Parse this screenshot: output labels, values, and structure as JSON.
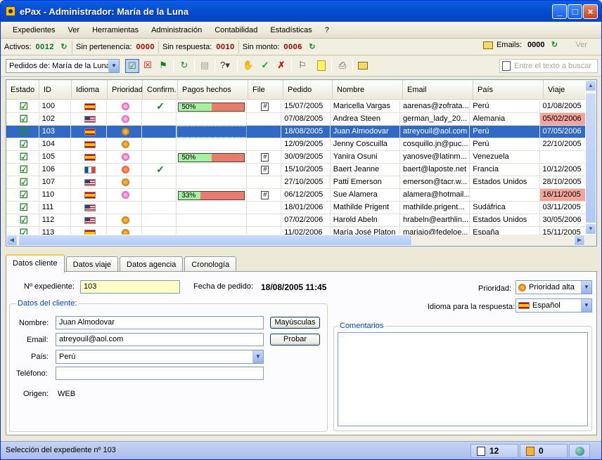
{
  "window": {
    "title": "ePax - Administrador: María de la Luna"
  },
  "menu": [
    "Expedientes",
    "Ver",
    "Herramientas",
    "Administración",
    "Contabilidad",
    "Estadísticas",
    "?"
  ],
  "counters": {
    "activos_label": "Activos:",
    "activos": "0012",
    "sin_pertenencia_label": "Sin pertenencia:",
    "sin_pertenencia": "0000",
    "sin_respuesta_label": "Sin respuesta:",
    "sin_respuesta": "0010",
    "sin_monto_label": "Sin monto:",
    "sin_monto": "0006",
    "emails_label": "Emails:",
    "emails": "0000",
    "ver_label": "Ver"
  },
  "toolbar": {
    "pedidos_combo": "Pedidos de: María de la Luna",
    "search_placeholder": "Entre el texto a buscar"
  },
  "grid": {
    "columns": [
      "Estado",
      "ID",
      "Idioma",
      "Prioridad",
      "Confirm.",
      "Pagos hechos",
      "File",
      "Pedido",
      "Nombre",
      "Email",
      "País",
      "Viaje"
    ],
    "rows": [
      {
        "id": "100",
        "lang": "es",
        "prio": "pink",
        "confirm": true,
        "pago": "50%",
        "pago_frac": 0.5,
        "file": true,
        "pedido": "15/07/2005",
        "nombre": "Maricella Vargas",
        "email": "aarenas@zofrata...",
        "pais": "Perú",
        "viaje": "01/08/2005",
        "viaje_hl": false
      },
      {
        "id": "102",
        "lang": "us",
        "prio": "pink",
        "confirm": false,
        "pago": "",
        "pago_frac": null,
        "file": false,
        "pedido": "07/08/2005",
        "nombre": "Andrea Steen",
        "email": "german_lady_20...",
        "pais": "Alemania",
        "viaje": "05/02/2006",
        "viaje_hl": true
      },
      {
        "id": "103",
        "lang": "es",
        "prio": "high",
        "confirm": false,
        "pago": "",
        "pago_frac": null,
        "file": false,
        "pedido": "18/08/2005",
        "nombre": "Juan Almodovar",
        "email": "atreyouil@aol.com",
        "pais": "Perú",
        "viaje": "07/05/2006",
        "viaje_hl": false,
        "selected": true
      },
      {
        "id": "104",
        "lang": "es",
        "prio": "high",
        "confirm": false,
        "pago": "",
        "pago_frac": null,
        "file": false,
        "pedido": "12/09/2005",
        "nombre": "Jenny Coscuilla",
        "email": "cosquillo.jn@puc...",
        "pais": "Perú",
        "viaje": "22/10/2005",
        "viaje_hl": false
      },
      {
        "id": "105",
        "lang": "es",
        "prio": "pink",
        "confirm": false,
        "pago": "50%",
        "pago_frac": 0.5,
        "file": true,
        "pedido": "30/09/2005",
        "nombre": "Yanira Osuni",
        "email": "yanosve@latinm...",
        "pais": "Venezuela",
        "viaje": "",
        "viaje_hl": false
      },
      {
        "id": "106",
        "lang": "fr",
        "prio": "red",
        "confirm": true,
        "pago": "",
        "pago_frac": null,
        "file": true,
        "pedido": "15/10/2005",
        "nombre": "Baert Jeanne",
        "email": "baert@laposte.net",
        "pais": "Francia",
        "viaje": "10/12/2005",
        "viaje_hl": false
      },
      {
        "id": "107",
        "lang": "us",
        "prio": "high",
        "confirm": false,
        "pago": "",
        "pago_frac": null,
        "file": false,
        "pedido": "27/10/2005",
        "nombre": "Patti Emerson",
        "email": "emerson@tacr.w...",
        "pais": "Estados Unidos",
        "viaje": "28/10/2005",
        "viaje_hl": false
      },
      {
        "id": "110",
        "lang": "es",
        "prio": "pink",
        "confirm": false,
        "pago": "33%",
        "pago_frac": 0.33,
        "file": true,
        "pedido": "06/12/2005",
        "nombre": "Sue Alamera",
        "email": "alamera@hotmail...",
        "pais": "",
        "viaje": "16/11/2005",
        "viaje_hl": true
      },
      {
        "id": "111",
        "lang": "us",
        "prio": "",
        "confirm": false,
        "pago": "",
        "pago_frac": null,
        "file": false,
        "pedido": "18/01/2006",
        "nombre": "Mathilde Prigent",
        "email": "mathilde.prigent...",
        "pais": "Sudáfrica",
        "viaje": "03/11/2005",
        "viaje_hl": false
      },
      {
        "id": "112",
        "lang": "us",
        "prio": "high",
        "confirm": false,
        "pago": "",
        "pago_frac": null,
        "file": false,
        "pedido": "07/02/2006",
        "nombre": "Harold Abeln",
        "email": "hrabeln@earthlin...",
        "pais": "Estados Unidos",
        "viaje": "30/05/2006",
        "viaje_hl": false
      },
      {
        "id": "113",
        "lang": "es",
        "prio": "high",
        "confirm": false,
        "pago": "",
        "pago_frac": null,
        "file": false,
        "pedido": "11/02/2006",
        "nombre": "María José Platon",
        "email": "mariajo@fedeloe...",
        "pais": "España",
        "viaje": "15/11/2005",
        "viaje_hl": false
      }
    ]
  },
  "tabs": [
    "Datos cliente",
    "Datos viaje",
    "Datos agencia",
    "Cronología"
  ],
  "form": {
    "expediente_label": "Nº expediente:",
    "expediente": "103",
    "fecha_label": "Fecha de pedido:",
    "fecha": "18/08/2005 11:45",
    "prioridad_label": "Prioridad:",
    "prioridad": "Prioridad alta",
    "idioma_label": "Idioma para la respuesta:",
    "idioma": "Español",
    "datos_cliente_title": "Datos del cliente:",
    "nombre_label": "Nombre:",
    "nombre": "Juan Almodovar",
    "email_label": "Email:",
    "email": "atreyouil@aol.com",
    "pais_label": "País:",
    "pais": "Perú",
    "telefono_label": "Teléfono:",
    "telefono": "",
    "origen_label": "Origen:",
    "origen": "WEB",
    "mayusculas_btn": "Mayúsculas",
    "probar_btn": "Probar",
    "comentarios_title": "Comentarios"
  },
  "statusbar": {
    "message": "Selección del expediente nº 103",
    "docs": "12",
    "alerts": "0"
  }
}
